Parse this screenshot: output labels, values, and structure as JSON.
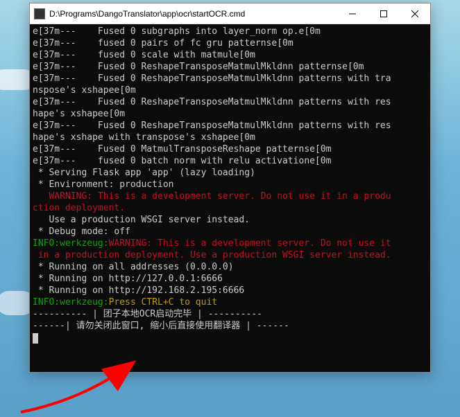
{
  "window": {
    "title": "D:\\Programs\\DangoTranslator\\app\\ocr\\startOCR.cmd"
  },
  "terminal": {
    "lines": [
      {
        "segments": [
          {
            "t": "e[37m---    Fused 0 subgraphs into layer_norm op.e[0m",
            "c": "white"
          }
        ]
      },
      {
        "segments": [
          {
            "t": "e[37m---    fused 0 pairs of fc gru patternse[0m",
            "c": "white"
          }
        ]
      },
      {
        "segments": [
          {
            "t": "e[37m---    fused 0 scale with matmule[0m",
            "c": "white"
          }
        ]
      },
      {
        "segments": [
          {
            "t": "e[37m---    Fused 0 ReshapeTransposeMatmulMkldnn patternse[0m",
            "c": "white"
          }
        ]
      },
      {
        "segments": [
          {
            "t": "e[37m---    Fused 0 ReshapeTransposeMatmulMkldnn patterns with tra",
            "c": "white"
          }
        ]
      },
      {
        "segments": [
          {
            "t": "nspose's xshapee[0m",
            "c": "white"
          }
        ]
      },
      {
        "segments": [
          {
            "t": "e[37m---    Fused 0 ReshapeTransposeMatmulMkldnn patterns with res",
            "c": "white"
          }
        ]
      },
      {
        "segments": [
          {
            "t": "hape's xshapee[0m",
            "c": "white"
          }
        ]
      },
      {
        "segments": [
          {
            "t": "e[37m---    Fused 0 ReshapeTransposeMatmulMkldnn patterns with res",
            "c": "white"
          }
        ]
      },
      {
        "segments": [
          {
            "t": "hape's xshape with transpose's xshapee[0m",
            "c": "white"
          }
        ]
      },
      {
        "segments": [
          {
            "t": "e[37m---    Fused 0 MatmulTransposeReshape patternse[0m",
            "c": "white"
          }
        ]
      },
      {
        "segments": [
          {
            "t": "e[37m---    fused 0 batch norm with relu activatione[0m",
            "c": "white"
          }
        ]
      },
      {
        "segments": [
          {
            "t": " * Serving Flask app 'app' (lazy loading)",
            "c": "white"
          }
        ]
      },
      {
        "segments": [
          {
            "t": " * Environment: production",
            "c": "white"
          }
        ]
      },
      {
        "segments": [
          {
            "t": "   WARNING: This is a development server. Do not use it in a produ",
            "c": "red"
          }
        ]
      },
      {
        "segments": [
          {
            "t": "ction deployment.",
            "c": "red"
          }
        ]
      },
      {
        "segments": [
          {
            "t": "   Use a production WSGI server instead.",
            "c": "white"
          }
        ]
      },
      {
        "segments": [
          {
            "t": " * Debug mode: off",
            "c": "white"
          }
        ]
      },
      {
        "segments": [
          {
            "t": "INFO:werkzeug:",
            "c": "green"
          },
          {
            "t": "WARNING: This is a development server. Do not use it",
            "c": "red"
          }
        ]
      },
      {
        "segments": [
          {
            "t": " in a production deployment. Use a production WSGI server instead.",
            "c": "red"
          }
        ]
      },
      {
        "segments": [
          {
            "t": "",
            "c": "white"
          }
        ]
      },
      {
        "segments": [
          {
            "t": " * Running on all addresses (0.0.0.0)",
            "c": "white"
          }
        ]
      },
      {
        "segments": [
          {
            "t": " * Running on http://127.0.0.1:6666",
            "c": "white"
          }
        ]
      },
      {
        "segments": [
          {
            "t": " * Running on http://192.168.2.195:6666",
            "c": "white"
          }
        ]
      },
      {
        "segments": [
          {
            "t": "INFO:werkzeug:",
            "c": "green"
          },
          {
            "t": "Press CTRL+C to quit",
            "c": "yellow"
          }
        ]
      },
      {
        "segments": [
          {
            "t": "",
            "c": "white"
          }
        ]
      },
      {
        "segments": [
          {
            "t": "---------- | 团子本地OCR启动完毕 | ----------",
            "c": "white"
          }
        ]
      },
      {
        "segments": [
          {
            "t": "------| 请勿关闭此窗口, 缩小后直接使用翻译器 | ------",
            "c": "white"
          }
        ]
      }
    ]
  }
}
